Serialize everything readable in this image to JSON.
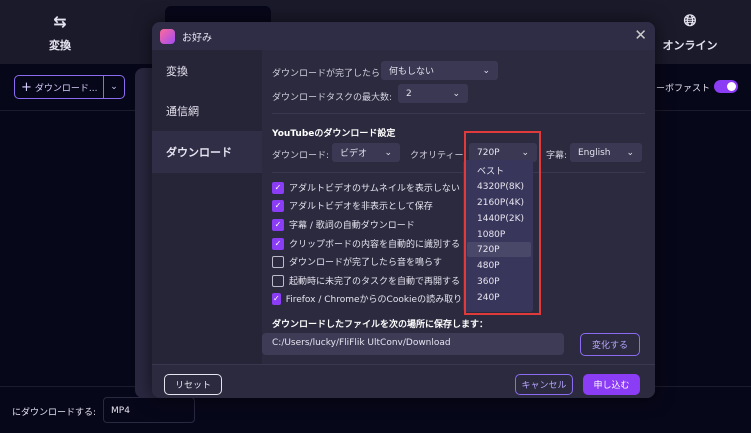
{
  "topnav": {
    "items": [
      {
        "label": "変換",
        "icon": "convert-arrows-icon"
      },
      {
        "label": "オンライン",
        "icon": "globe-icon"
      }
    ]
  },
  "toolbar": {
    "download_button": "ダウンロード...",
    "turbo_label": "ーボファスト",
    "turbo_on": true
  },
  "bottom": {
    "format_label": "にダウンロードする:",
    "format_value": "MP4"
  },
  "dialog": {
    "title": "お好み",
    "sidebar": [
      {
        "label": "変換"
      },
      {
        "label": "通信網"
      },
      {
        "label": "ダウンロード",
        "active": true
      }
    ],
    "after_complete_label": "ダウンロードが完了したら",
    "after_complete_value": "何もしない",
    "max_tasks_label": "ダウンロードタスクの最大数:",
    "max_tasks_value": "2",
    "youtube_heading": "YouTubeのダウンロード設定",
    "download_label": "ダウンロード:",
    "download_value": "ビデオ",
    "quality_label": "クオリティー:",
    "quality_value": "720P",
    "subtitle_label": "字幕:",
    "subtitle_value": "English",
    "quality_options": [
      "ベスト",
      "4320P(8K)",
      "2160P(4K)",
      "1440P(2K)",
      "1080P",
      "720P",
      "480P",
      "360P",
      "240P"
    ],
    "checkboxes": [
      {
        "label": "アダルトビデオのサムネイルを表示しない",
        "checked": true
      },
      {
        "label": "アダルトビデオを非表示として保存",
        "checked": true
      },
      {
        "label": "字幕 / 歌詞の自動ダウンロード",
        "checked": true
      },
      {
        "label": "クリップボードの内容を自動的に識別する",
        "checked": true
      },
      {
        "label": "ダウンロードが完了したら音を鳴らす",
        "checked": false
      },
      {
        "label": "起動時に未完了のタスクを自動で再開する",
        "checked": false
      },
      {
        "label": "Firefox / ChromeからのCookieの読み取りを許",
        "checked": true
      }
    ],
    "save_location_label": "ダウンロードしたファイルを次の場所に保存します：",
    "save_path": "C:/Users/lucky/FliFlik UltConv/Download",
    "change_button": "変化する",
    "reset_button": "リセット",
    "cancel_button": "キャンセル",
    "apply_button": "申し込む"
  },
  "colors": {
    "accent": "#8b3cf5",
    "highlight_box": "#e03a3a"
  }
}
